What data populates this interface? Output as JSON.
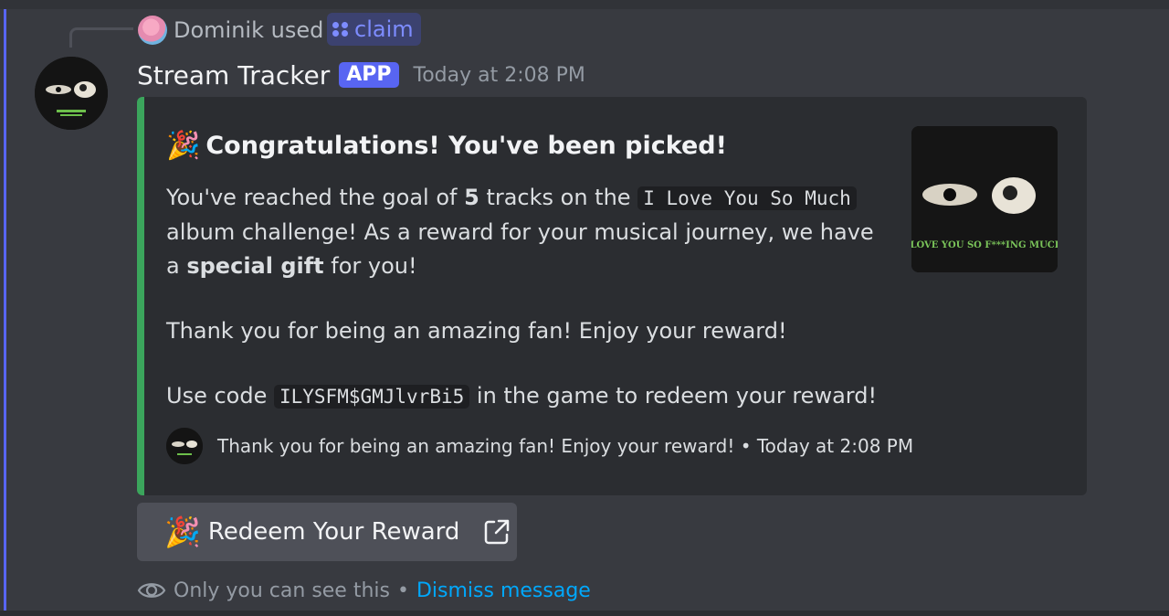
{
  "reply": {
    "user_text": "Dominik used",
    "command": "claim"
  },
  "message": {
    "author": "Stream Tracker",
    "badge": "APP",
    "timestamp": "Today at 2:08 PM"
  },
  "embed": {
    "accent_color": "#3ba55c",
    "title_emoji": "🎉",
    "title": "Congratulations! You've been picked!",
    "body": {
      "p1_a": "You've reached the goal of ",
      "p1_goal": "5",
      "p1_b": " tracks on the ",
      "p1_album": "I Love You So Much",
      "p1_c": " album challenge! As a reward for your musical journey, we have a ",
      "p1_gift": "special gift",
      "p1_d": " for you!",
      "p2": "Thank you for being an amazing fan! Enjoy your reward!",
      "p3_a": "Use code ",
      "p3_code": "ILYSFM$GMJlvrBi5",
      "p3_b": " in the game to redeem your reward!"
    },
    "thumbnail_text": "I LOVE YOU SO F***ING MUCH.",
    "footer_text": "Thank you for being an amazing fan! Enjoy your reward! • Today at 2:08 PM"
  },
  "button": {
    "emoji": "🎉",
    "label": "Redeem Your Reward"
  },
  "ephemeral": {
    "notice": "Only you can see this",
    "separator": "•",
    "dismiss": "Dismiss message"
  }
}
